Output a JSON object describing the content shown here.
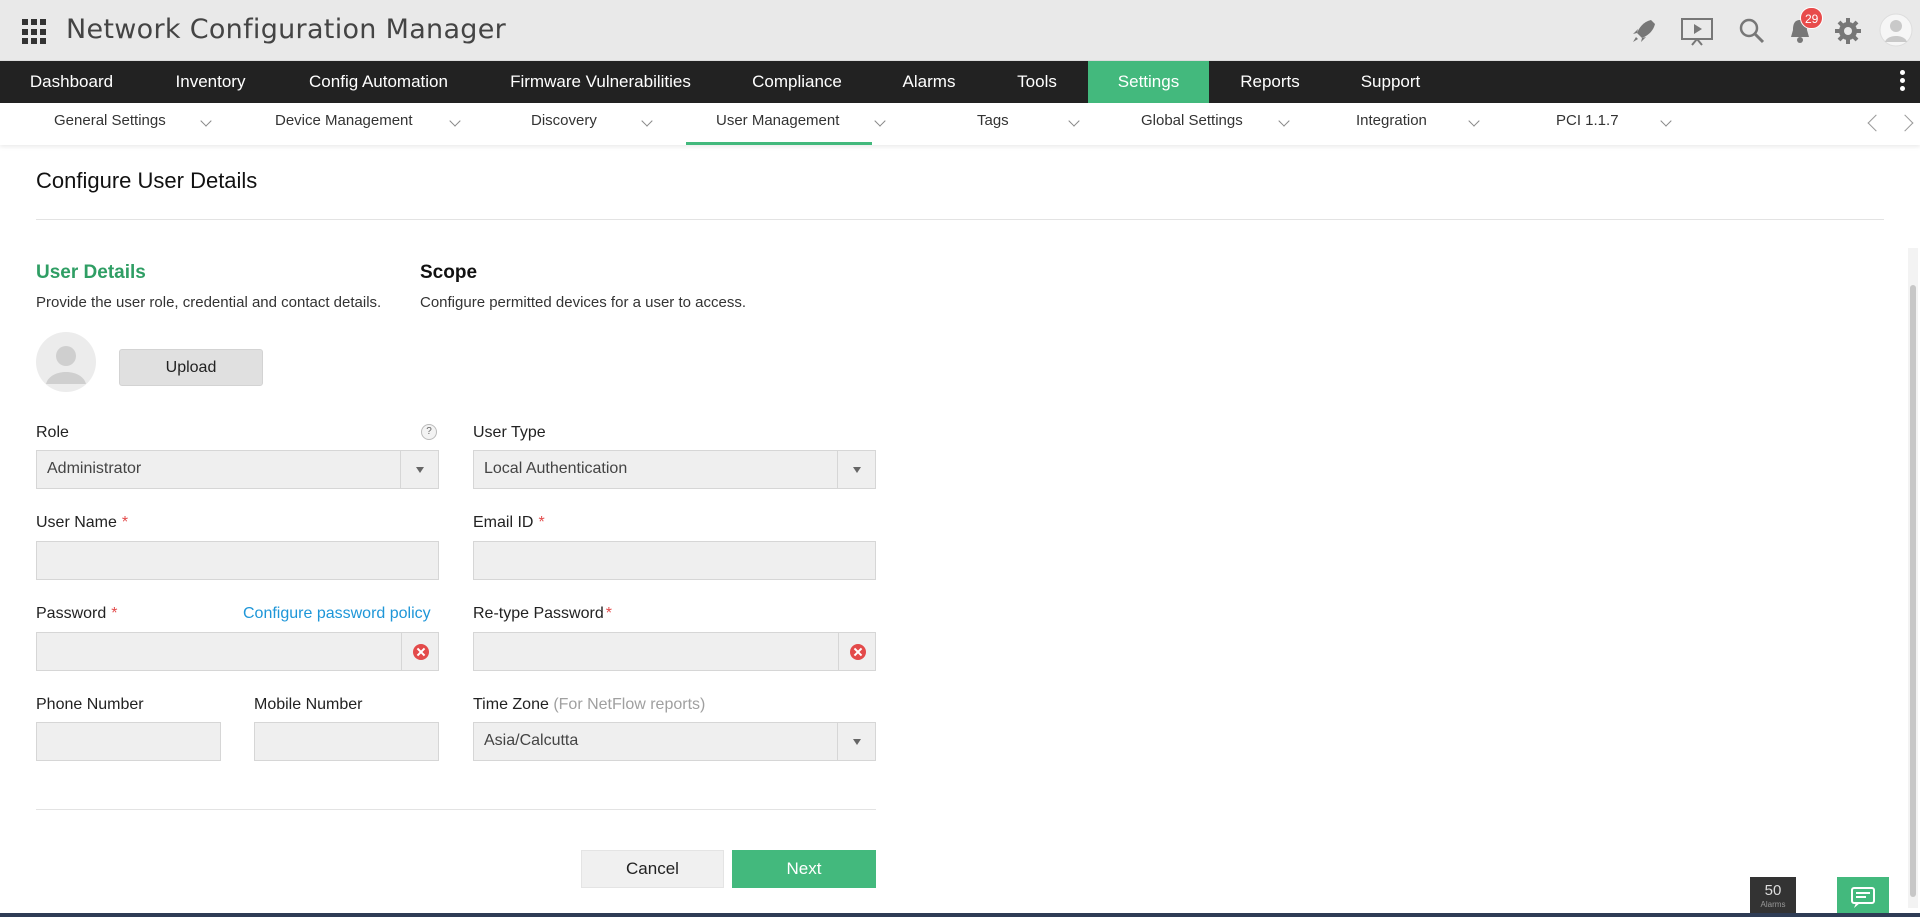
{
  "header": {
    "app_title": "Network Configuration Manager",
    "notification_count": "29",
    "icons": [
      "apps-grid-icon",
      "rocket-icon",
      "presentation-icon",
      "search-icon",
      "bell-icon",
      "gear-icon",
      "user-avatar-icon"
    ]
  },
  "main_nav": {
    "items": [
      {
        "label": "Dashboard"
      },
      {
        "label": "Inventory"
      },
      {
        "label": "Config Automation"
      },
      {
        "label": "Firmware Vulnerabilities"
      },
      {
        "label": "Compliance"
      },
      {
        "label": "Alarms"
      },
      {
        "label": "Tools"
      },
      {
        "label": "Settings"
      },
      {
        "label": "Reports"
      },
      {
        "label": "Support"
      }
    ],
    "active": "Settings",
    "active_color": "#43b97d"
  },
  "sub_nav": {
    "items": [
      {
        "label": "General Settings"
      },
      {
        "label": "Device Management"
      },
      {
        "label": "Discovery"
      },
      {
        "label": "User Management"
      },
      {
        "label": "Tags"
      },
      {
        "label": "Global Settings"
      },
      {
        "label": "Integration"
      },
      {
        "label": "PCI 1.1.7"
      }
    ],
    "active": "User Management"
  },
  "page": {
    "title": "Configure User Details",
    "steps": [
      {
        "title": "User Details",
        "desc": "Provide the user role, credential and contact details."
      },
      {
        "title": "Scope",
        "desc": "Configure permitted devices for a user to access."
      }
    ],
    "upload_label": "Upload"
  },
  "form": {
    "role": {
      "label": "Role",
      "value": "Administrator"
    },
    "user_type": {
      "label": "User Type",
      "value": "Local Authentication"
    },
    "user_name": {
      "label": "User Name",
      "value": ""
    },
    "email": {
      "label": "Email ID",
      "value": ""
    },
    "password": {
      "label": "Password",
      "value": "",
      "policy_link": "Configure password policy"
    },
    "retype_password": {
      "label": "Re-type Password",
      "value": ""
    },
    "phone": {
      "label": "Phone Number",
      "value": ""
    },
    "mobile": {
      "label": "Mobile Number",
      "value": ""
    },
    "time_zone": {
      "label": "Time Zone",
      "hint": "(For NetFlow reports)",
      "value": "Asia/Calcutta"
    },
    "required_mark": "*",
    "help_mark": "?"
  },
  "actions": {
    "cancel": "Cancel",
    "next": "Next"
  },
  "footer": {
    "alarm_count": "50",
    "alarm_label": "Alarms"
  },
  "colors": {
    "accent": "#43b97d",
    "step_active": "#2f9e64",
    "link": "#1e96d8",
    "required": "#e34a4a",
    "nav_bg": "#222222"
  }
}
